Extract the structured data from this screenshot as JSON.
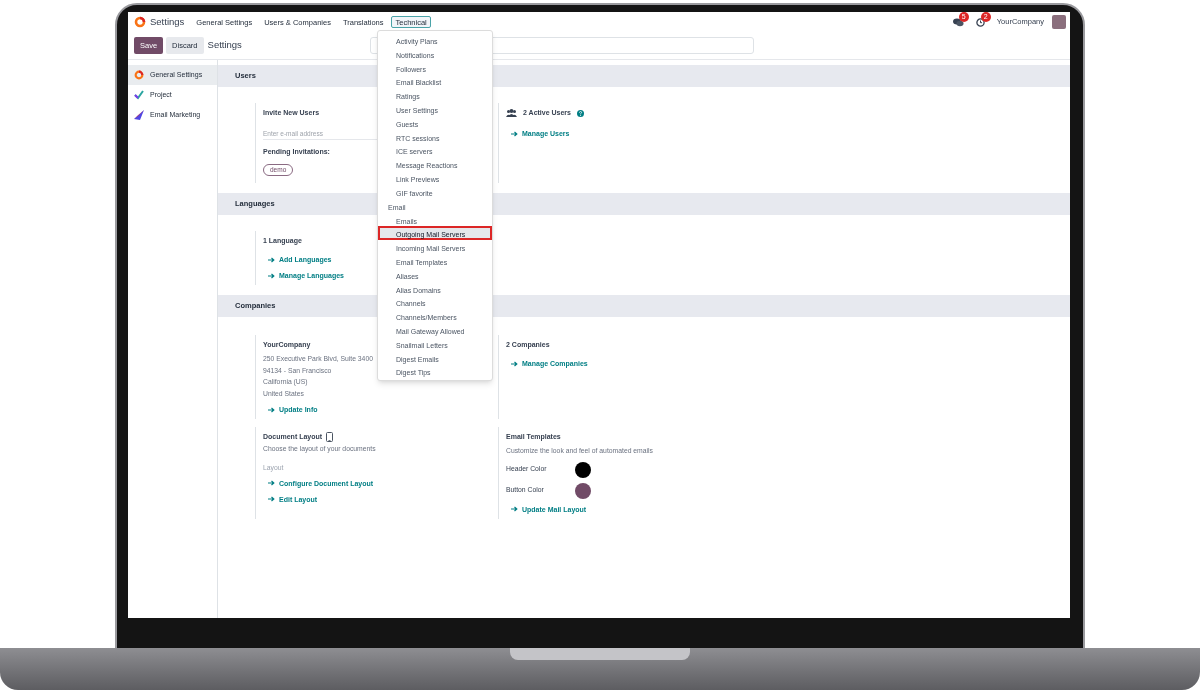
{
  "app_bar": {
    "app_name": "Settings",
    "menu": [
      {
        "label": "General Settings",
        "selected": false
      },
      {
        "label": "Users & Companies",
        "selected": false
      },
      {
        "label": "Translations",
        "selected": false
      },
      {
        "label": "Technical",
        "selected": true
      }
    ],
    "chat_badge": "5",
    "activity_badge": "2",
    "company": "YourCompany"
  },
  "control_panel": {
    "save": "Save",
    "discard": "Discard",
    "breadcrumb": "Settings"
  },
  "sidebar": {
    "items": [
      {
        "label": "General Settings",
        "kind": "general",
        "selected": true
      },
      {
        "label": "Project",
        "kind": "project",
        "selected": false
      },
      {
        "label": "Email Marketing",
        "kind": "marketing",
        "selected": false
      }
    ]
  },
  "technical_menu": {
    "items": [
      {
        "kind": "item",
        "label": "Activity Plans",
        "selected": false
      },
      {
        "kind": "item",
        "label": "Notifications",
        "selected": false
      },
      {
        "kind": "item",
        "label": "Followers",
        "selected": false
      },
      {
        "kind": "item",
        "label": "Email Blacklist",
        "selected": false
      },
      {
        "kind": "item",
        "label": "Ratings",
        "selected": false
      },
      {
        "kind": "item",
        "label": "User Settings",
        "selected": false
      },
      {
        "kind": "item",
        "label": "Guests",
        "selected": false
      },
      {
        "kind": "item",
        "label": "RTC sessions",
        "selected": false
      },
      {
        "kind": "item",
        "label": "ICE servers",
        "selected": false
      },
      {
        "kind": "item",
        "label": "Message Reactions",
        "selected": false
      },
      {
        "kind": "item",
        "label": "Link Previews",
        "selected": false
      },
      {
        "kind": "item",
        "label": "GIF favorite",
        "selected": false
      },
      {
        "kind": "header",
        "label": "Email"
      },
      {
        "kind": "item",
        "label": "Emails",
        "selected": false
      },
      {
        "kind": "item",
        "label": "Outgoing Mail Servers",
        "selected": true
      },
      {
        "kind": "item",
        "label": "Incoming Mail Servers",
        "selected": false
      },
      {
        "kind": "item",
        "label": "Email Templates",
        "selected": false
      },
      {
        "kind": "item",
        "label": "Aliases",
        "selected": false
      },
      {
        "kind": "item",
        "label": "Alias Domains",
        "selected": false
      },
      {
        "kind": "item",
        "label": "Channels",
        "selected": false
      },
      {
        "kind": "item",
        "label": "Channels/Members",
        "selected": false
      },
      {
        "kind": "item",
        "label": "Mail Gateway Allowed",
        "selected": false
      },
      {
        "kind": "item",
        "label": "Snailmail Letters",
        "selected": false
      },
      {
        "kind": "item",
        "label": "Digest Emails",
        "selected": false
      },
      {
        "kind": "item",
        "label": "Digest Tips",
        "selected": false
      }
    ]
  },
  "sections": [
    {
      "title": "Users",
      "blocks": [
        {
          "lines": [
            {
              "kind": "title",
              "text": "Invite New Users"
            },
            {
              "kind": "input",
              "placeholder": "Enter e-mail address"
            },
            {
              "kind": "label",
              "text": "Pending Invitations:"
            },
            {
              "kind": "chip",
              "text": "demo"
            }
          ]
        },
        {
          "lines": [
            {
              "kind": "users_title",
              "text": "2 Active Users"
            },
            {
              "kind": "link",
              "text": "Manage Users"
            }
          ]
        }
      ]
    },
    {
      "title": "Languages",
      "blocks": [
        {
          "lines": [
            {
              "kind": "title",
              "text": "1 Language"
            },
            {
              "kind": "link",
              "text": "Add Languages"
            },
            {
              "kind": "link",
              "text": "Manage Languages"
            }
          ]
        }
      ]
    },
    {
      "title": "Companies",
      "blocks": [
        {
          "lines": [
            {
              "kind": "title",
              "text": "YourCompany"
            },
            {
              "kind": "muted",
              "text": "250 Executive Park Blvd, Suite 3400"
            },
            {
              "kind": "muted",
              "text": "94134 - San Francisco"
            },
            {
              "kind": "muted",
              "text": "California (US)"
            },
            {
              "kind": "muted",
              "text": "United States"
            },
            {
              "kind": "link",
              "text": "Update Info"
            }
          ]
        },
        {
          "lines": [
            {
              "kind": "title",
              "text": "2 Companies"
            },
            {
              "kind": "link",
              "text": "Manage Companies"
            }
          ]
        },
        {
          "lines": [
            {
              "kind": "layout_title",
              "text": "Document Layout"
            },
            {
              "kind": "muted",
              "text": "Choose the layout of your documents"
            },
            {
              "kind": "caption",
              "text": "Layout"
            },
            {
              "kind": "link",
              "text": "Configure Document Layout"
            },
            {
              "kind": "link",
              "text": "Edit Layout"
            }
          ]
        },
        {
          "lines": [
            {
              "kind": "title",
              "text": "Email Templates"
            },
            {
              "kind": "muted",
              "text": "Customize the look and feel of automated emails"
            },
            {
              "kind": "color",
              "text": "Header Color",
              "color": "#000000"
            },
            {
              "kind": "color",
              "text": "Button Color",
              "color": "#714b67"
            },
            {
              "kind": "link",
              "text": "Update Mail Layout"
            }
          ]
        }
      ]
    }
  ]
}
